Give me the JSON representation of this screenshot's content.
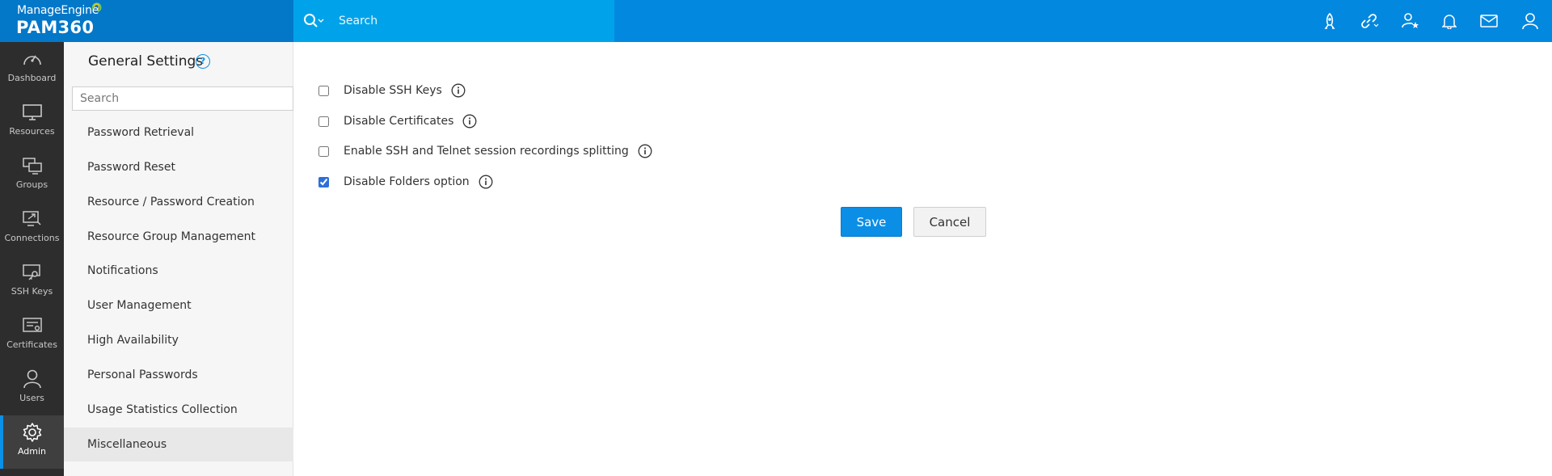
{
  "brand": {
    "vendor": "ManageEngine",
    "product": "PAM360"
  },
  "top_search": {
    "placeholder": "Search"
  },
  "top_icons": [
    "rocket-icon",
    "link-icon",
    "user-star-icon",
    "bell-icon",
    "mail-icon",
    "user-icon"
  ],
  "left_nav": [
    {
      "label": "Dashboard",
      "icon": "dashboard-icon"
    },
    {
      "label": "Resources",
      "icon": "monitor-icon"
    },
    {
      "label": "Groups",
      "icon": "groups-icon"
    },
    {
      "label": "Connections",
      "icon": "connections-icon"
    },
    {
      "label": "SSH Keys",
      "icon": "ssh-keys-icon"
    },
    {
      "label": "Certificates",
      "icon": "certificates-icon"
    },
    {
      "label": "Users",
      "icon": "user-icon"
    },
    {
      "label": "Admin",
      "icon": "gear-icon",
      "active": true
    }
  ],
  "sidebar": {
    "title": "General Settings",
    "help": "?",
    "search_placeholder": "Search",
    "items": [
      {
        "label": "Password Retrieval"
      },
      {
        "label": "Password Reset"
      },
      {
        "label": "Resource / Password Creation"
      },
      {
        "label": "Resource Group Management"
      },
      {
        "label": "Notifications"
      },
      {
        "label": "User Management"
      },
      {
        "label": "High Availability"
      },
      {
        "label": "Personal Passwords"
      },
      {
        "label": "Usage Statistics Collection"
      },
      {
        "label": "Miscellaneous",
        "active": true
      }
    ]
  },
  "options": [
    {
      "label": "Disable SSH Keys",
      "checked": false
    },
    {
      "label": "Disable Certificates",
      "checked": false
    },
    {
      "label": "Enable SSH and Telnet session recordings splitting",
      "checked": false
    },
    {
      "label": "Disable Folders option",
      "checked": true
    }
  ],
  "actions": {
    "save": "Save",
    "cancel": "Cancel"
  },
  "colors": {
    "topbar": "#0388e0",
    "search_bg": "#00a3ea",
    "brand_bg": "#0377c8",
    "nav_bg": "#2d2d2d",
    "accent": "#0b8ee6"
  }
}
